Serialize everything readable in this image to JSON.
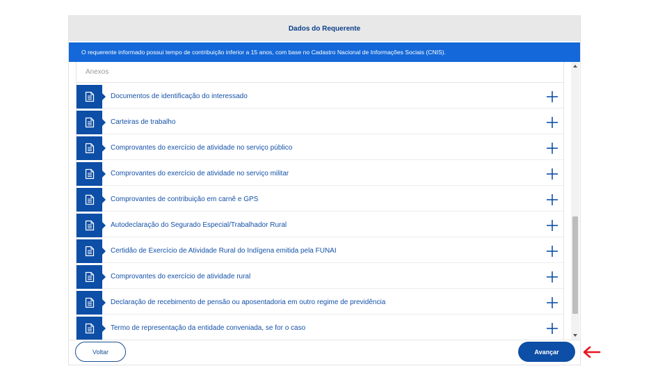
{
  "header": {
    "title": "Dados do Requerente"
  },
  "notice": {
    "text": "O requerente informado possui tempo de contribuição inferior a 15 anos, com base no Cadastro Nacional de Informações Sociais (CNIS)."
  },
  "attachments": {
    "section_title": "Anexos",
    "items": [
      {
        "label": "Documentos de identificação do interessado"
      },
      {
        "label": "Carteiras de trabalho"
      },
      {
        "label": "Comprovantes do exercício de atividade no serviço público"
      },
      {
        "label": "Comprovantes do exercício de atividade no serviço militar"
      },
      {
        "label": "Comprovantes de contribuição em carnê e GPS"
      },
      {
        "label": "Autodeclaração do Segurado Especial/Trabalhador Rural"
      },
      {
        "label": "Certidão de Exercício de Atividade Rural do Indígena emitida pela FUNAI"
      },
      {
        "label": "Comprovantes do exercício de atividade rural"
      },
      {
        "label": "Declaração de recebimento de pensão ou aposentadoria em outro regime de previdência"
      },
      {
        "label": "Termo de representação da entidade conveniada, se for o caso"
      }
    ]
  },
  "footer": {
    "back_label": "Voltar",
    "next_label": "Avançar"
  },
  "colors": {
    "primary": "#0d4ea6",
    "notice_bg": "#1468d9",
    "header_bg": "#e8e8e8",
    "arrow": "#e8141c"
  }
}
